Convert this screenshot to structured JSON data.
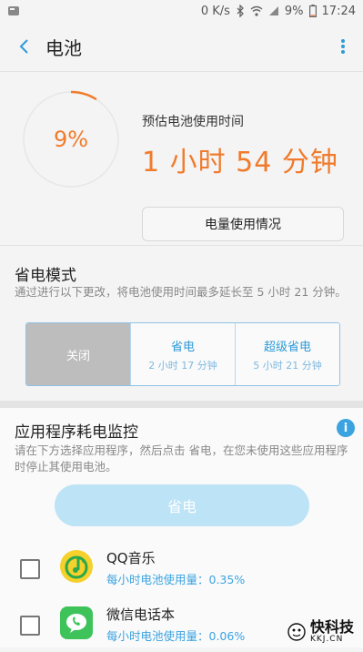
{
  "status_bar": {
    "net_speed": "0 K/s",
    "battery_percent": "9%",
    "time": "17:24"
  },
  "app_bar": {
    "title": "电池"
  },
  "battery": {
    "percent": "9%",
    "level": 0.09,
    "est_label": "预估电池使用时间",
    "est_time": "1 小时 54 分钟",
    "usage_button": "电量使用情况"
  },
  "power_saving": {
    "title": "省电模式",
    "description": "通过进行以下更改，将电池使用时间最多延长至 5 小时 21 分钟。",
    "options": [
      {
        "label": "关闭",
        "sub": "",
        "selected": true
      },
      {
        "label": "省电",
        "sub": "2 小时 17 分钟",
        "selected": false
      },
      {
        "label": "超级省电",
        "sub": "5 小时 21 分钟",
        "selected": false
      }
    ]
  },
  "monitor": {
    "title": "应用程序耗电监控",
    "description": "请在下方选择应用程序，然后点击 省电，在您未使用这些应用程序时停止其使用电池。",
    "save_button": "省电",
    "apps": [
      {
        "name": "QQ音乐",
        "usage": "每小时电池使用量：0.35%"
      },
      {
        "name": "微信电话本",
        "usage": "每小时电池使用量：0.06%"
      }
    ]
  },
  "watermark": {
    "text": "快科技",
    "sub": "KKJ.CN"
  },
  "colors": {
    "accent_orange": "#f07b2c",
    "accent_blue": "#3aa3e0"
  }
}
